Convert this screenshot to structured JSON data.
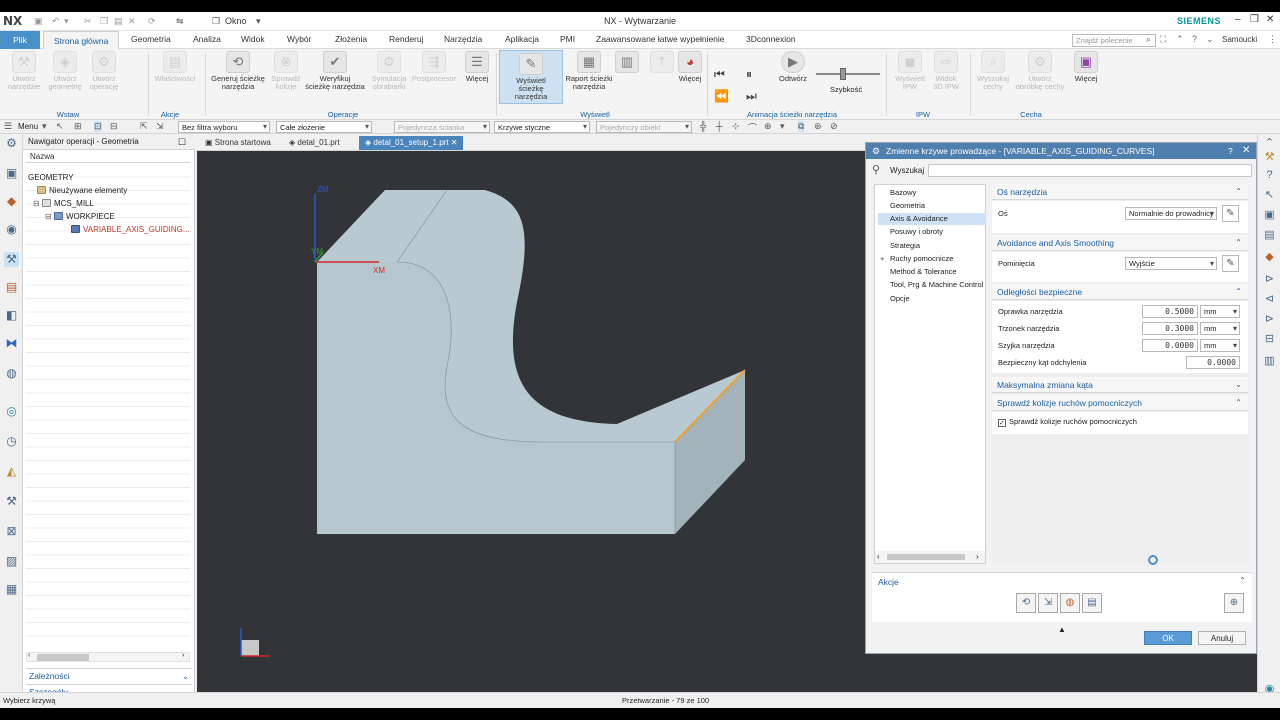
{
  "titlebar": {
    "logo": "NX",
    "window_label": "Okno",
    "title": "NX - Wytwarzanie",
    "brand": "SIEMENS"
  },
  "tabs": {
    "file": "Plik",
    "items": [
      "Strona główna",
      "Geometria",
      "Analiza",
      "Widok",
      "Wybór",
      "Złożenia",
      "Renderuj",
      "Narzędzia",
      "Aplikacja",
      "PMI",
      "Zaawansowane łatwe wypełnienie",
      "3Dconnexion"
    ],
    "search_placeholder": "Znajdź polecenie",
    "user": "Samoucki"
  },
  "ribbon": {
    "buttons": [
      {
        "label": "Utwórz\nnarzędzie",
        "disabled": true
      },
      {
        "label": "Utwórz\ngeometrię",
        "disabled": true
      },
      {
        "label": "Utwórz\noperację",
        "disabled": true
      },
      {
        "label": "Właściwości",
        "disabled": true
      },
      {
        "label": "Generuj ścieżkę\nnarzędzia",
        "disabled": false
      },
      {
        "label": "Sprawdź\nkolizje",
        "disabled": true
      },
      {
        "label": "Weryfikuj\nścieżkę narzędzia",
        "disabled": false
      },
      {
        "label": "Symulacja\nobrabiarki",
        "disabled": true
      },
      {
        "label": "Postprocesor",
        "disabled": true
      },
      {
        "label": "Więcej",
        "disabled": false
      },
      {
        "label": "Wyświetl ścieżkę\nnarzędzia",
        "disabled": false
      },
      {
        "label": "Raport ścieżki\nnarzędzia",
        "disabled": false
      },
      {
        "label": "Więcej",
        "disabled": false
      },
      {
        "label": "Odtwórz",
        "disabled": false
      },
      {
        "label": "Szybkość",
        "disabled": false
      },
      {
        "label": "Wyświetl\nIPW",
        "disabled": true
      },
      {
        "label": "Widok\n3D IPW",
        "disabled": true
      },
      {
        "label": "Wyszukaj\ncechy",
        "disabled": true
      },
      {
        "label": "Utwórz\nobróbkę cechy",
        "disabled": true
      },
      {
        "label": "Więcej",
        "disabled": false
      }
    ],
    "groups": [
      "Wstaw",
      "Akcje",
      "Operacje",
      "Wyświetl",
      "Animacja ścieżki narzędzia",
      "IPW",
      "Cecha"
    ]
  },
  "toolbar": {
    "menu": "Menu",
    "filter": "Bez filtra wyboru",
    "scope": "Całe złożenie",
    "face": "Pojedyncza ścianka",
    "curve": "Krzywe styczne",
    "object": "Pojedynczy obiekt"
  },
  "navigator": {
    "title": "Nawigator operacji - Geometria",
    "column": "Nazwa",
    "tree": [
      "GEOMETRY",
      "Nieużywane elementy",
      "MCS_MILL",
      "WORKPIECE",
      "VARIABLE_AXIS_GUIDING..."
    ],
    "sections": [
      "Zależności",
      "Szczegóły"
    ]
  },
  "doc_tabs": [
    "Strona startowa",
    "detal_01.prt",
    "detal_01_setup_1.prt"
  ],
  "viewport": {
    "axis_labels": [
      "ZM",
      "YM",
      "XM"
    ],
    "model_colors": {
      "top": "#b9c9d2",
      "front": "#b5c5cd",
      "side": "#a3b3bc",
      "edge": "#f0a030",
      "background": "#333438"
    }
  },
  "dialog": {
    "title": "Zmienne krzywe prowadzące - [VARIABLE_AXIS_GUIDING_CURVES]",
    "search_label": "Wyszukaj",
    "categories": [
      "Bazowy",
      "Geometria",
      "Axis & Avoidance",
      "Posuwy i obroty",
      "Strategia",
      "Ruchy pomocnicze",
      "Method & Tolerance",
      "Tool, Prg & Machine Control",
      "Opcje"
    ],
    "selected_category": "Axis & Avoidance",
    "sections": {
      "tool_axis": {
        "title": "Oś narzędzia",
        "axis_label": "Oś",
        "axis_value": "Normalnie do prowadnicy"
      },
      "avoidance": {
        "title": "Avoidance and Axis Smoothing",
        "skip_label": "Pominięcia",
        "skip_value": "Wyjście"
      },
      "clearance": {
        "title": "Odległości bezpieczne",
        "rows": [
          {
            "label": "Oprawka narzędzia",
            "value": "0.5000",
            "unit": "mm"
          },
          {
            "label": "Trzonek narzędzia",
            "value": "0.3000",
            "unit": "mm"
          },
          {
            "label": "Szyjka narzędzia",
            "value": "0.0000",
            "unit": "mm"
          }
        ],
        "tilt_label": "Bezpieczny kąt odchylenia",
        "tilt_value": "0.0000"
      },
      "max_angle": {
        "title": "Maksymalna zmiana kąta"
      },
      "collision": {
        "title": "Sprawdź kolizje ruchów pomocniczych",
        "checkbox_label": "Sprawdź kolizje ruchów pomocniczych",
        "checked": true
      }
    },
    "actions_label": "Akcje",
    "ok": "OK",
    "cancel": "Anuluj"
  },
  "status": {
    "left": "Wybierz krzywą",
    "center": "Przetwarzanie - 79 ze 100"
  }
}
